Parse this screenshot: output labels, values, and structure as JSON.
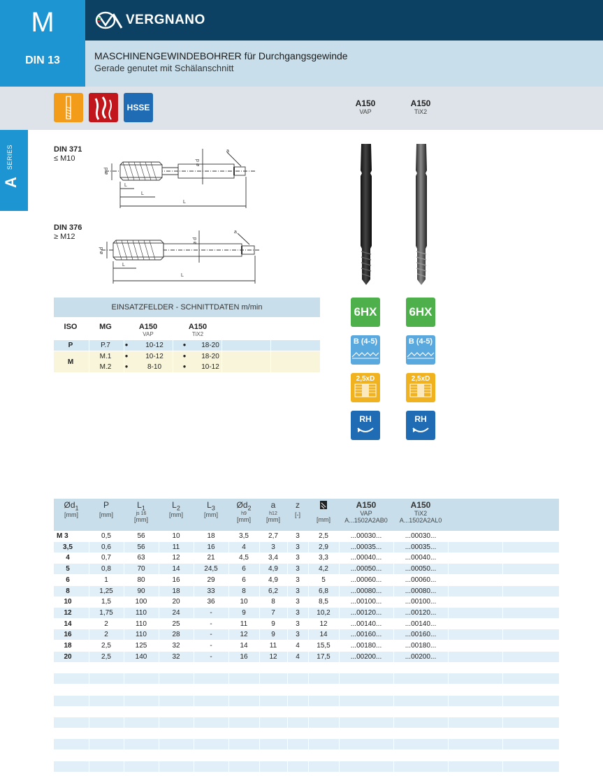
{
  "header": {
    "series_letter": "M",
    "standard": "DIN 13",
    "brand": "VERGNANO",
    "title": "MASCHINENGEWINDEBOHRER für Durchgangsgewinde",
    "subtitle": "Gerade genutet mit Schälanschnitt"
  },
  "badges": {
    "hsse": "HSSE"
  },
  "columns": [
    {
      "name": "A150",
      "coating": "VAP"
    },
    {
      "name": "A150",
      "coating": "TiX2"
    }
  ],
  "side_tab": {
    "letter": "A",
    "label": "SERIES"
  },
  "drawings": [
    {
      "standard": "DIN 371",
      "range": "≤ M10"
    },
    {
      "standard": "DIN 376",
      "range": "≥ M12"
    }
  ],
  "drawing_labels": {
    "d1": "ø d",
    "d1_sub": "1",
    "d2": "ø d",
    "d2_sub": "2",
    "a": "a",
    "L": "L",
    "L1_sub": "1",
    "L2_sub": "2",
    "L3_sub": "3"
  },
  "cutting_data": {
    "title": "EINSATZFELDER - SCHNITTDATEN m/min",
    "headers": {
      "iso": "ISO",
      "mg": "MG"
    },
    "rows": [
      {
        "iso": "P",
        "mg": "P.7",
        "v1": "10-12",
        "v2": "18-20"
      },
      {
        "iso": "M",
        "mg": "M.1",
        "v1": "10-12",
        "v2": "18-20"
      },
      {
        "iso": "",
        "mg": "M.2",
        "v1": "8-10",
        "v2": "10-12"
      }
    ],
    "bullet": "●"
  },
  "icons": {
    "tolerance": "6HX",
    "chamfer": "B (4-5)",
    "depth": "2,5xD",
    "hand": "RH"
  },
  "main_table": {
    "headers": [
      {
        "label": "Ød",
        "label_sub": "1",
        "tol": "",
        "unit": "[mm]"
      },
      {
        "label": "P",
        "label_sub": "",
        "tol": "",
        "unit": "[mm]"
      },
      {
        "label": "L",
        "label_sub": "1",
        "tol": "js 16",
        "unit": "[mm]"
      },
      {
        "label": "L",
        "label_sub": "2",
        "tol": "",
        "unit": "[mm]"
      },
      {
        "label": "L",
        "label_sub": "3",
        "tol": "",
        "unit": "[mm]"
      },
      {
        "label": "Ød",
        "label_sub": "2",
        "tol": "h9",
        "unit": "[mm]"
      },
      {
        "label": "a",
        "label_sub": "",
        "tol": "h12",
        "unit": "[mm]"
      },
      {
        "label": "z",
        "label_sub": "",
        "tol": "",
        "unit": "[-]"
      },
      {
        "label": "",
        "label_sub": "",
        "tol": "",
        "unit": "[mm]"
      }
    ],
    "code_headers": [
      {
        "name": "A150",
        "coating": "VAP",
        "code": "A...1502A2AB0"
      },
      {
        "name": "A150",
        "coating": "TiX2",
        "code": "A...1502A2AL0"
      }
    ],
    "rows": [
      [
        "M 3",
        "0,5",
        "56",
        "10",
        "18",
        "3,5",
        "2,7",
        "3",
        "2,5",
        "...00030...",
        "...00030..."
      ],
      [
        "3,5",
        "0,6",
        "56",
        "11",
        "16",
        "4",
        "3",
        "3",
        "2,9",
        "...00035...",
        "...00035..."
      ],
      [
        "4",
        "0,7",
        "63",
        "12",
        "21",
        "4,5",
        "3,4",
        "3",
        "3,3",
        "...00040...",
        "...00040..."
      ],
      [
        "5",
        "0,8",
        "70",
        "14",
        "24,5",
        "6",
        "4,9",
        "3",
        "4,2",
        "...00050...",
        "...00050..."
      ],
      [
        "6",
        "1",
        "80",
        "16",
        "29",
        "6",
        "4,9",
        "3",
        "5",
        "...00060...",
        "...00060..."
      ],
      [
        "8",
        "1,25",
        "90",
        "18",
        "33",
        "8",
        "6,2",
        "3",
        "6,8",
        "...00080...",
        "...00080..."
      ],
      [
        "10",
        "1,5",
        "100",
        "20",
        "36",
        "10",
        "8",
        "3",
        "8,5",
        "...00100...",
        "...00100..."
      ],
      [
        "12",
        "1,75",
        "110",
        "24",
        "-",
        "9",
        "7",
        "3",
        "10,2",
        "...00120...",
        "...00120..."
      ],
      [
        "14",
        "2",
        "110",
        "25",
        "-",
        "11",
        "9",
        "3",
        "12",
        "...00140...",
        "...00140..."
      ],
      [
        "16",
        "2",
        "110",
        "28",
        "-",
        "12",
        "9",
        "3",
        "14",
        "...00160...",
        "...00160..."
      ],
      [
        "18",
        "2,5",
        "125",
        "32",
        "-",
        "14",
        "11",
        "4",
        "15,5",
        "...00180...",
        "...00180..."
      ],
      [
        "20",
        "2,5",
        "140",
        "32",
        "-",
        "16",
        "12",
        "4",
        "17,5",
        "...00200...",
        "...00200..."
      ]
    ]
  },
  "colors": {
    "navy": "#0d4163",
    "cyan": "#1d95d2",
    "light_blue": "#c8dfeb",
    "row_alt": "#e1eff8",
    "green": "#4db04a",
    "orange": "#f39c1a",
    "red": "#c0161c",
    "blue": "#1f6cb5"
  }
}
